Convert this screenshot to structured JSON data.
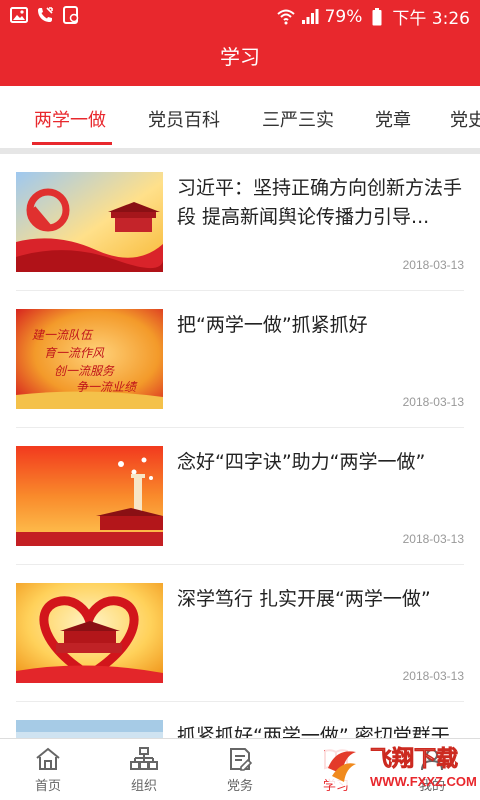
{
  "status_bar": {
    "battery": "79%",
    "time": "下午 3:26"
  },
  "app_bar": {
    "title": "学习"
  },
  "tabs": [
    {
      "label": "两学一做",
      "active": true
    },
    {
      "label": "党员百科"
    },
    {
      "label": "三严三实"
    },
    {
      "label": "党章"
    },
    {
      "label": "党史"
    }
  ],
  "articles": [
    {
      "title": "习近平：坚持正确方向创新方法手段 提高新闻舆论传播力引导...",
      "date": "2018-03-13"
    },
    {
      "title": "把“两学一做”抓紧抓好",
      "date": "2018-03-13"
    },
    {
      "title": "念好“四字诀”助力“两学一做”",
      "date": "2018-03-13"
    },
    {
      "title": "深学笃行 扎实开展“两学一做”",
      "date": "2018-03-13"
    },
    {
      "title": "抓紧抓好“两学一做” 密切党群干",
      "date": ""
    }
  ],
  "thumb2_text": [
    "建一流队伍",
    "育一流作风",
    "创一流服务",
    "争一流业绩"
  ],
  "bottom_nav": [
    {
      "label": "首页",
      "icon": "home-icon"
    },
    {
      "label": "组织",
      "icon": "org-chart-icon"
    },
    {
      "label": "党务",
      "icon": "document-edit-icon"
    },
    {
      "label": "学习",
      "icon": "book-icon",
      "active": true
    },
    {
      "label": "我的",
      "icon": "user-icon"
    }
  ],
  "watermark": {
    "brand": "飞翔下载",
    "url": "WWW.FXXZ.COM"
  },
  "colors": {
    "primary": "#e8282d",
    "tab_inactive": "#333333",
    "date": "#999999"
  }
}
